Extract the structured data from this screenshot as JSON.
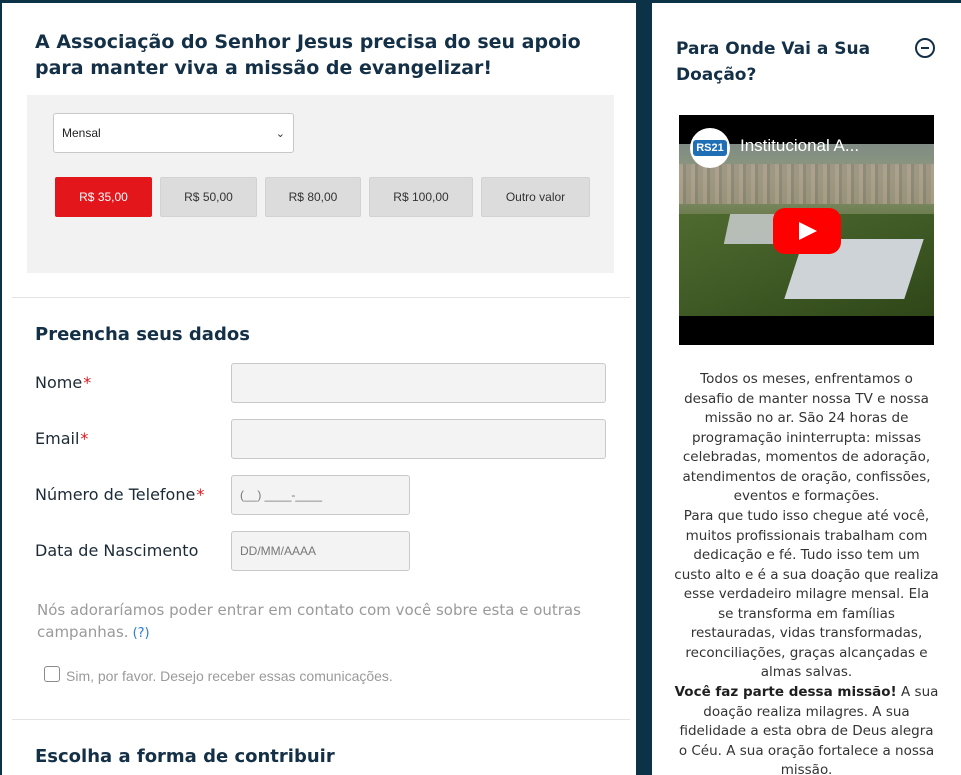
{
  "campaign": {
    "headline": "A Associação do Senhor Jesus precisa do seu apoio para manter viva a missão de evangelizar!",
    "frequency": "Mensal",
    "amounts": [
      "R$ 35,00",
      "R$ 50,00",
      "R$ 80,00",
      "R$ 100,00",
      "Outro valor"
    ],
    "selected_amount": "R$ 35,00"
  },
  "form": {
    "title": "Preencha seus dados",
    "required_mark": "*",
    "name_label": "Nome",
    "email_label": "Email",
    "phone_label": "Número de Telefone",
    "phone_placeholder": "(__) ____-____",
    "birth_label": "Data de Nascimento",
    "birth_placeholder": "DD/MM/AAAA",
    "consent_text": "Nós adoraríamos poder entrar em contato com você sobre esta e outras campanhas.",
    "consent_help": "(?)",
    "checkbox_label": "Sim, por favor. Desejo receber essas comunicações."
  },
  "contribution": {
    "title": "Escolha a forma de contribuir"
  },
  "sidebar": {
    "title": "Para Onde Vai a Sua Doação?",
    "video": {
      "title": "Institucional A...",
      "channel_logo": "RS21"
    },
    "paragraph1": "Todos os meses, enfrentamos o desafio de manter nossa TV e nossa missão no ar. São 24 horas de programação ininterrupta: missas celebradas, momentos de adoração, atendimentos de oração, confissões, eventos e formações.",
    "paragraph2": "Para que tudo isso chegue até você, muitos profissionais trabalham com dedicação e fé. Tudo isso tem um custo alto e é a sua doação que realiza esse verdadeiro milagre mensal. Ela se transforma em famílias restauradas, vidas transformadas, reconciliações, graças alcançadas e almas salvas.",
    "paragraph3_bold": "Você faz parte dessa missão!",
    "paragraph3_rest": " A sua doação realiza milagres. A sua fidelidade a esta obra de Deus alegra o Céu. A sua oração fortalece a nossa missão."
  },
  "colors": {
    "accent": "#e3161c",
    "navy": "#143047",
    "frame": "#0b3246"
  },
  "icons": [
    "chevron-down-icon",
    "collapse-icon",
    "play-icon"
  ]
}
